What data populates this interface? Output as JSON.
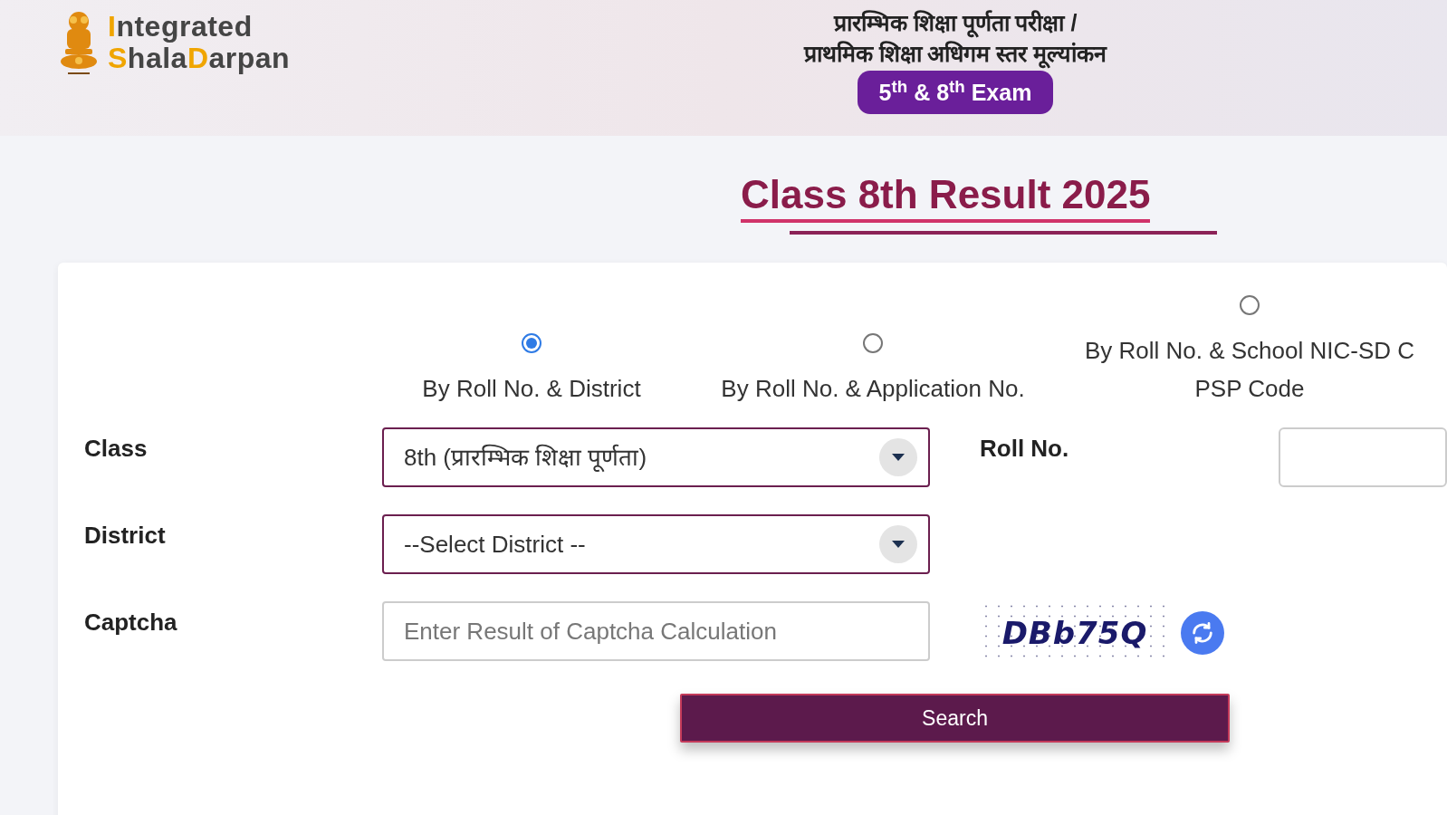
{
  "header": {
    "logo_lines": [
      [
        {
          "text": "I",
          "accent": true
        },
        {
          "text": "ntegrated",
          "accent": false
        }
      ],
      [
        {
          "text": "S",
          "accent": true
        },
        {
          "text": "hala",
          "accent": false
        },
        {
          "text": "D",
          "accent": true
        },
        {
          "text": "arpan",
          "accent": false
        }
      ]
    ],
    "exam_title_lines": [
      "प्रारम्भिक शिक्षा पूर्णता परीक्षा /",
      "प्राथमिक शिक्षा अधिगम स्तर मूल्यांकन"
    ],
    "exam_badge": "5$^{th}$ & 8$^{th}$ Exam"
  },
  "page_title": "Class 8th Result 2025",
  "search_modes": [
    {
      "label_lines": [
        "By Roll No. & District"
      ],
      "selected": true
    },
    {
      "label_lines": [
        "By Roll No. & Application No."
      ],
      "selected": false
    },
    {
      "label_lines": [
        "By Roll No. & School NIC-SD C",
        "PSP Code"
      ],
      "selected": false
    }
  ],
  "form": {
    "class_label": "Class",
    "class_value": "8th (प्रारम्भिक शिक्षा पूर्णता)",
    "roll_label": "Roll No.",
    "district_label": "District",
    "district_value": "--Select District --",
    "captcha_label": "Captcha",
    "captcha_placeholder": "Enter Result of Captcha Calculation",
    "captcha_text": "DBb75Q"
  },
  "search_button": "Search"
}
